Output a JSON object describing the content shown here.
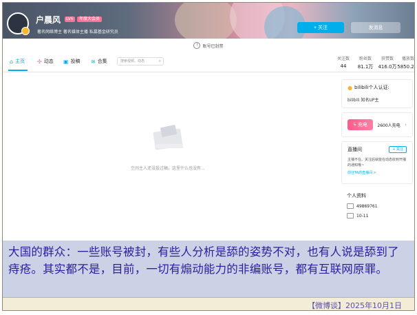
{
  "header": {
    "username": "户晨风",
    "level": "LV6",
    "vip": "年度大会员",
    "sign": "著名网络博主 著名媒体主播 私募基金研究员",
    "follow_label": "+ 关注",
    "message_label": "发消息"
  },
  "notice": {
    "text": "账号已封禁"
  },
  "nav": {
    "tabs": [
      {
        "label": "主页",
        "icon": "home-icon"
      },
      {
        "label": "动态",
        "icon": "dynamic-icon"
      },
      {
        "label": "投稿",
        "icon": "upload-icon"
      },
      {
        "label": "合集",
        "icon": "collection-icon"
      }
    ],
    "search_placeholder": "搜索视频、动态"
  },
  "stats": [
    {
      "label": "关注数",
      "value": "44"
    },
    {
      "label": "粉丝数",
      "value": "81.1万"
    },
    {
      "label": "获赞数",
      "value": "416.0万"
    },
    {
      "label": "播放数",
      "value": "5850.2万"
    }
  ],
  "main": {
    "empty_text": "空间主人还没投过稿，这里什么也没有..."
  },
  "sidebar": {
    "cert_title": "bilibili个人认证:",
    "cert_text": "bilibili 知名UP主",
    "charge_label": "充电",
    "charge_count": "2600人充电",
    "live_title": "直播间",
    "live_follow": "+ 关注",
    "live_text": "主播不在。关注后就能在动态收到开播的通知哦~",
    "live_link": "前往TA的直播间 >",
    "profile_title": "个人资料",
    "uid": "49869761",
    "birthday": "10-11"
  },
  "caption": {
    "text": "大国的群众：一些账号被封，有些人分析是舔的姿势不对，也有人说是舔到了痔疮。其实都不是，目前，一切有煽动能力的非编账号，都有互联网原罪。"
  },
  "footer": {
    "text": "【微博谈】2025年10月1日"
  },
  "colors": {
    "accent": "#00aeec",
    "pink": "#fb7299",
    "caption_bg": "#ccd2e6",
    "caption_text": "#2a1f9e"
  }
}
